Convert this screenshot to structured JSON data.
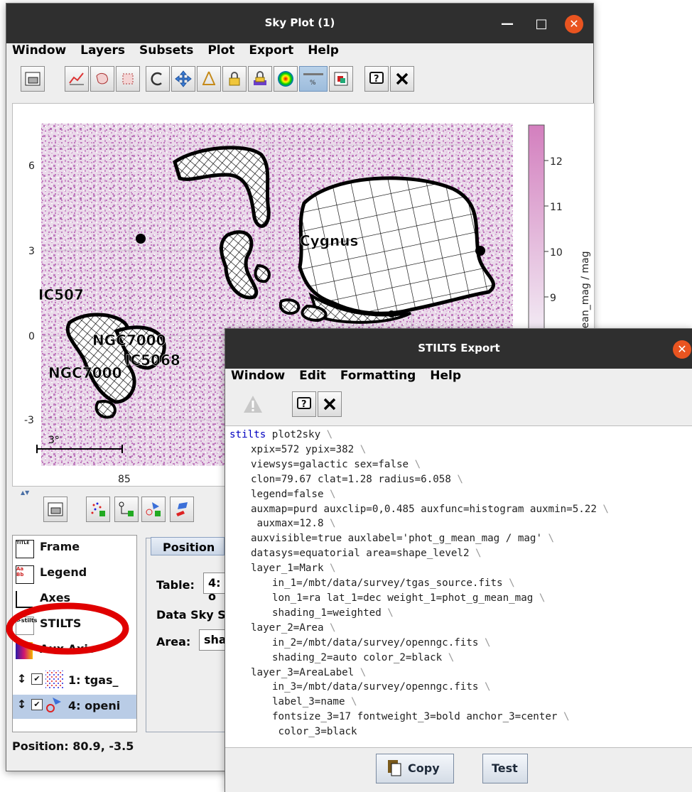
{
  "sky_window": {
    "title": "Sky Plot (1)",
    "menu": [
      "Window",
      "Layers",
      "Subsets",
      "Plot",
      "Export",
      "Help"
    ],
    "toolbar_icons": [
      "frame-icon",
      "plot-area-icon",
      "blob-icon",
      "region-icon",
      "replot-icon",
      "navigate-icon",
      "compass-icon",
      "axis-lock-icon",
      "aux-lock-icon",
      "density-icon",
      "aux-range-icon",
      "image-export-icon",
      "help-icon",
      "close-icon"
    ],
    "plot": {
      "y_ticks": [
        "6",
        "3",
        "0",
        "-3"
      ],
      "x_ticks": [
        "85"
      ],
      "scale_bar_label": "3°",
      "labels": [
        "IC507",
        "Cygnus",
        "NGC7000",
        "IC5068",
        "NGC7000"
      ],
      "colorbar": {
        "ticks": [
          "12",
          "11",
          "10",
          "9"
        ],
        "label": "mean_mag / mag",
        "low_color": "#f3eef6",
        "high_color": "#d37fbe"
      },
      "point_color": "#c98cc8"
    },
    "control_icons": [
      "frame-add-icon",
      "mark-add-icon",
      "link-add-icon",
      "area-add-icon",
      "area-label-add-icon"
    ],
    "sidebar": [
      {
        "label": "Frame",
        "icon": "title-icon"
      },
      {
        "label": "Legend",
        "icon": "legend-icon"
      },
      {
        "label": "Axes",
        "icon": "axes-icon"
      },
      {
        "label": "STILTS",
        "icon": "stilts-icon"
      },
      {
        "label": "Aux Axis",
        "icon": "aux-axis-icon"
      },
      {
        "label": "1: tgas_",
        "icon": "mark-layer-icon"
      },
      {
        "label": "4: openi",
        "icon": "area-layer-icon"
      }
    ],
    "position_tab": "Position",
    "table_label": "Table:",
    "table_value": "4: o",
    "data_sky_label": "Data Sky S",
    "area_label": "Area:",
    "area_value": "sha",
    "status": "Position: 80.9, -3.5",
    "highlight_color": "#e00000"
  },
  "stilts_window": {
    "title": "STILTS Export",
    "menu": [
      "Window",
      "Edit",
      "Formatting",
      "Help"
    ],
    "code_lines": [
      {
        "indent": 0,
        "text": "stilts plot2sky"
      },
      {
        "indent": 1,
        "text": "xpix=572 ypix=382"
      },
      {
        "indent": 1,
        "text": "viewsys=galactic sex=false"
      },
      {
        "indent": 1,
        "text": "clon=79.67 clat=1.28 radius=6.058"
      },
      {
        "indent": 1,
        "text": "legend=false"
      },
      {
        "indent": 1,
        "text": "auxmap=purd auxclip=0,0.485 auxfunc=histogram auxmin=5.22"
      },
      {
        "indent": 1,
        "text": " auxmax=12.8"
      },
      {
        "indent": 1,
        "text": "auxvisible=true auxlabel='phot_g_mean_mag / mag'"
      },
      {
        "indent": 1,
        "text": "datasys=equatorial area=shape_level2"
      },
      {
        "indent": 1,
        "text": "layer_1=Mark"
      },
      {
        "indent": 2,
        "text": "in_1=/mbt/data/survey/tgas_source.fits"
      },
      {
        "indent": 2,
        "text": "lon_1=ra lat_1=dec weight_1=phot_g_mean_mag"
      },
      {
        "indent": 2,
        "text": "shading_1=weighted"
      },
      {
        "indent": 1,
        "text": "layer_2=Area"
      },
      {
        "indent": 2,
        "text": "in_2=/mbt/data/survey/openngc.fits"
      },
      {
        "indent": 2,
        "text": "shading_2=auto color_2=black"
      },
      {
        "indent": 1,
        "text": "layer_3=AreaLabel"
      },
      {
        "indent": 2,
        "text": "in_3=/mbt/data/survey/openngc.fits"
      },
      {
        "indent": 2,
        "text": "label_3=name"
      },
      {
        "indent": 2,
        "text": "fontsize_3=17 fontweight_3=bold anchor_3=center"
      },
      {
        "indent": 2,
        "text": " color_3=black"
      }
    ],
    "copy_label": "Copy",
    "test_label": "Test",
    "keyword_color": "#0000c0"
  }
}
